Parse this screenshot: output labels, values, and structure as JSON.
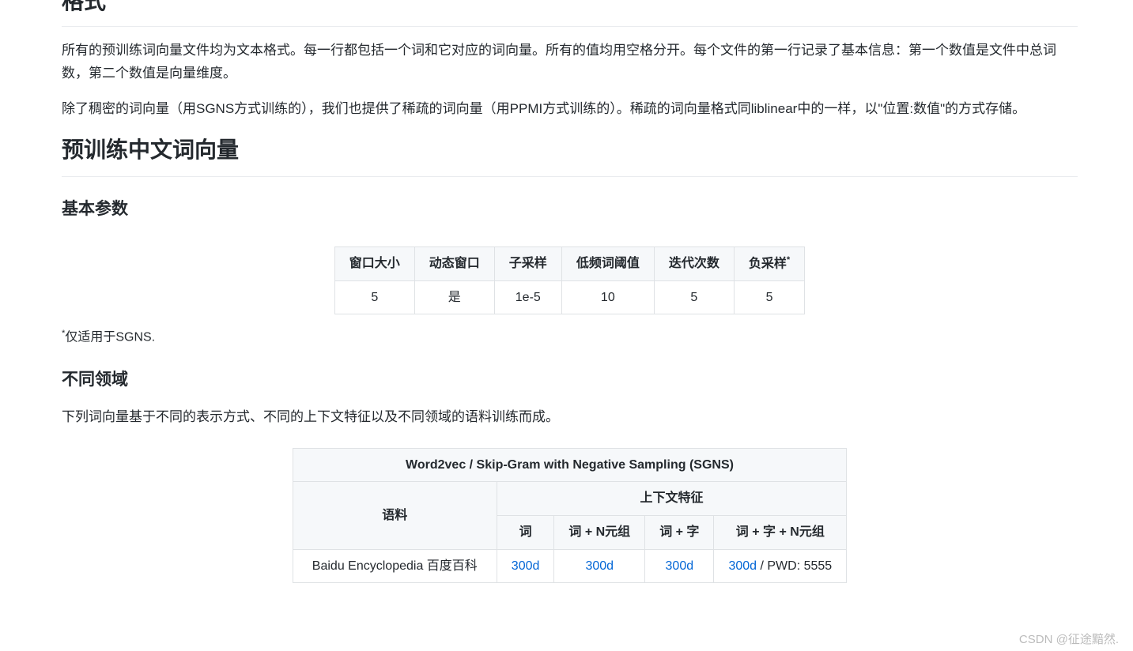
{
  "format": {
    "title": "格式",
    "p1": "所有的预训练词向量文件均为文本格式。每一行都包括一个词和它对应的词向量。所有的值均用空格分开。每个文件的第一行记录了基本信息：第一个数值是文件中总词数，第二个数值是向量维度。",
    "p2": "除了稠密的词向量（用SGNS方式训练的），我们也提供了稀疏的词向量（用PPMI方式训练的）。稀疏的词向量格式同liblinear中的一样，以\"位置:数值\"的方式存储。"
  },
  "pretrained": {
    "title": "预训练中文词向量",
    "params_heading": "基本参数",
    "params_headers": [
      "窗口大小",
      "动态窗口",
      "子采样",
      "低频词阈值",
      "迭代次数",
      "负采样"
    ],
    "params_values": [
      "5",
      "是",
      "1e-5",
      "10",
      "5",
      "5"
    ],
    "asterisk": "*",
    "note_prefix": "*",
    "note_text": "仅适用于SGNS.",
    "domains_heading": "不同领域",
    "domains_intro": "下列词向量基于不同的表示方式、不同的上下文特征以及不同领域的语料训练而成。",
    "corpus_table": {
      "header_main": "Word2vec / Skip-Gram with Negative Sampling (SGNS)",
      "header_corpus": "语料",
      "header_context": "上下文特征",
      "context_cols": [
        "词",
        "词 + N元组",
        "词 + 字",
        "词 + 字 + N元组"
      ],
      "row1_corpus": "Baidu Encyclopedia 百度百科",
      "link_text": "300d",
      "pwd_text": " / PWD: 5555"
    }
  },
  "watermark": "CSDN @征途黯然."
}
